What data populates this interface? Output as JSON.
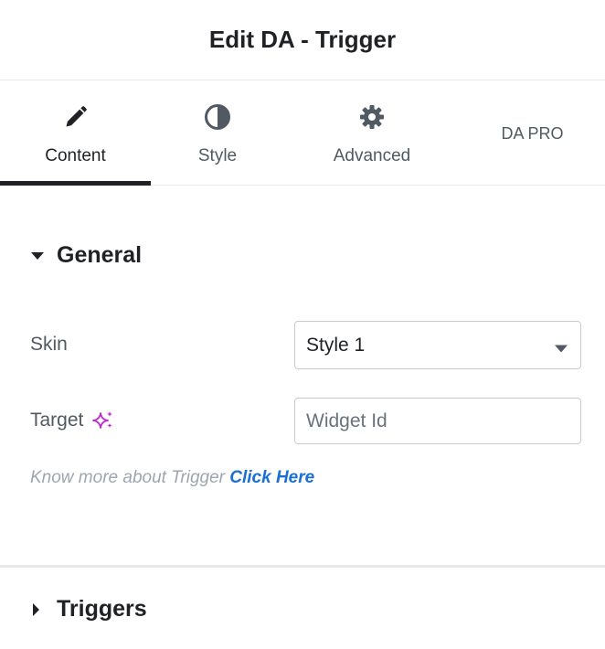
{
  "header": {
    "title": "Edit DA - Trigger"
  },
  "tabs": [
    {
      "label": "Content",
      "icon": "pencil-icon",
      "active": true
    },
    {
      "label": "Style",
      "icon": "half-circle-icon",
      "active": false
    },
    {
      "label": "Advanced",
      "icon": "gear-icon",
      "active": false
    },
    {
      "label": "DA PRO",
      "icon": "",
      "active": false
    }
  ],
  "sections": {
    "general": {
      "title": "General",
      "expanded": true,
      "fields": {
        "skin": {
          "label": "Skin",
          "value": "Style 1"
        },
        "target": {
          "label": "Target",
          "placeholder": "Widget Id",
          "value": "",
          "icon": "ai-sparkle-icon"
        }
      },
      "help": {
        "text": "Know more about Trigger ",
        "link_text": "Click Here"
      }
    },
    "triggers": {
      "title": "Triggers",
      "expanded": false
    }
  },
  "colors": {
    "accent_text": "#1f2124",
    "link": "#1a6fd1",
    "sparkle": "#c026d3",
    "border": "#c8ccd0"
  }
}
